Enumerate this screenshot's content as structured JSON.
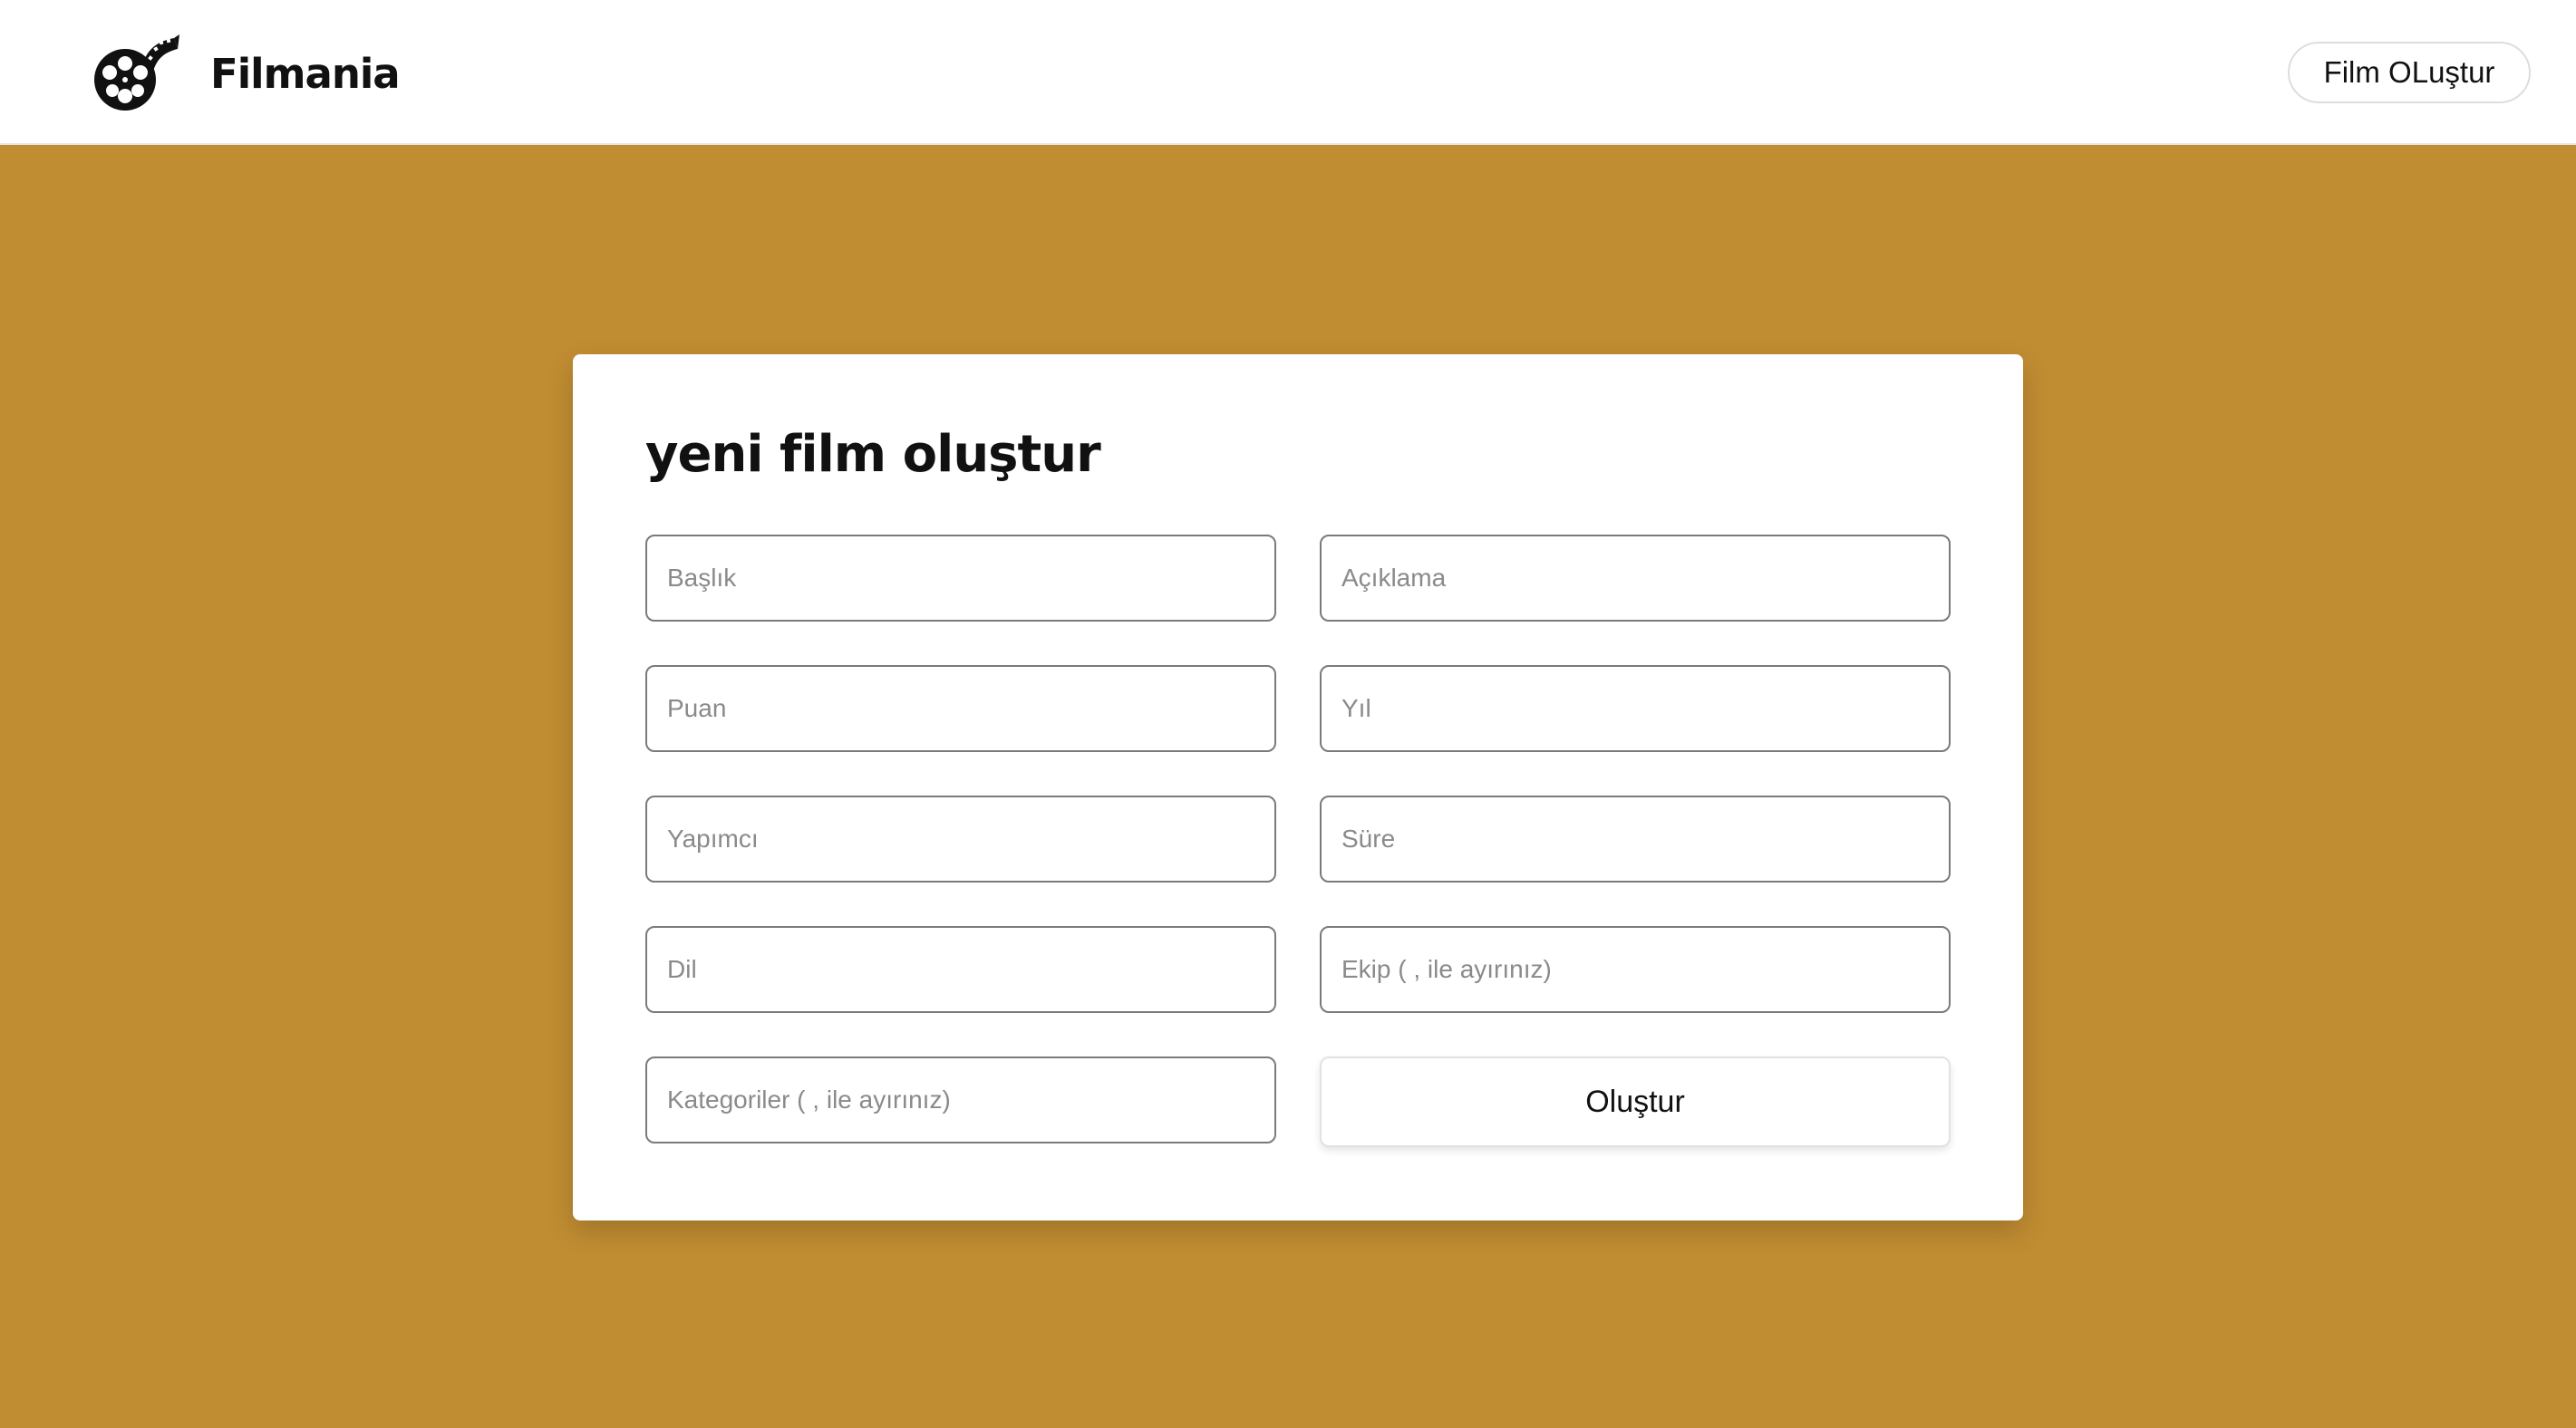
{
  "header": {
    "brand": "Filmania",
    "logo_icon": "film-reel-icon",
    "create_film_label": "Film OLuştur"
  },
  "form": {
    "title": "yeni film oluştur",
    "fields": {
      "title_placeholder": "Başlık",
      "description_placeholder": "Açıklama",
      "rating_placeholder": "Puan",
      "year_placeholder": "Yıl",
      "producer_placeholder": "Yapımcı",
      "duration_placeholder": "Süre",
      "language_placeholder": "Dil",
      "crew_placeholder": "Ekip ( , ile ayırınız)",
      "categories_placeholder": "Kategoriler ( , ile ayırınız)"
    },
    "submit_label": "Oluştur"
  },
  "colors": {
    "background": "#c18d32",
    "card": "#ffffff",
    "navbar": "#ffffff"
  }
}
